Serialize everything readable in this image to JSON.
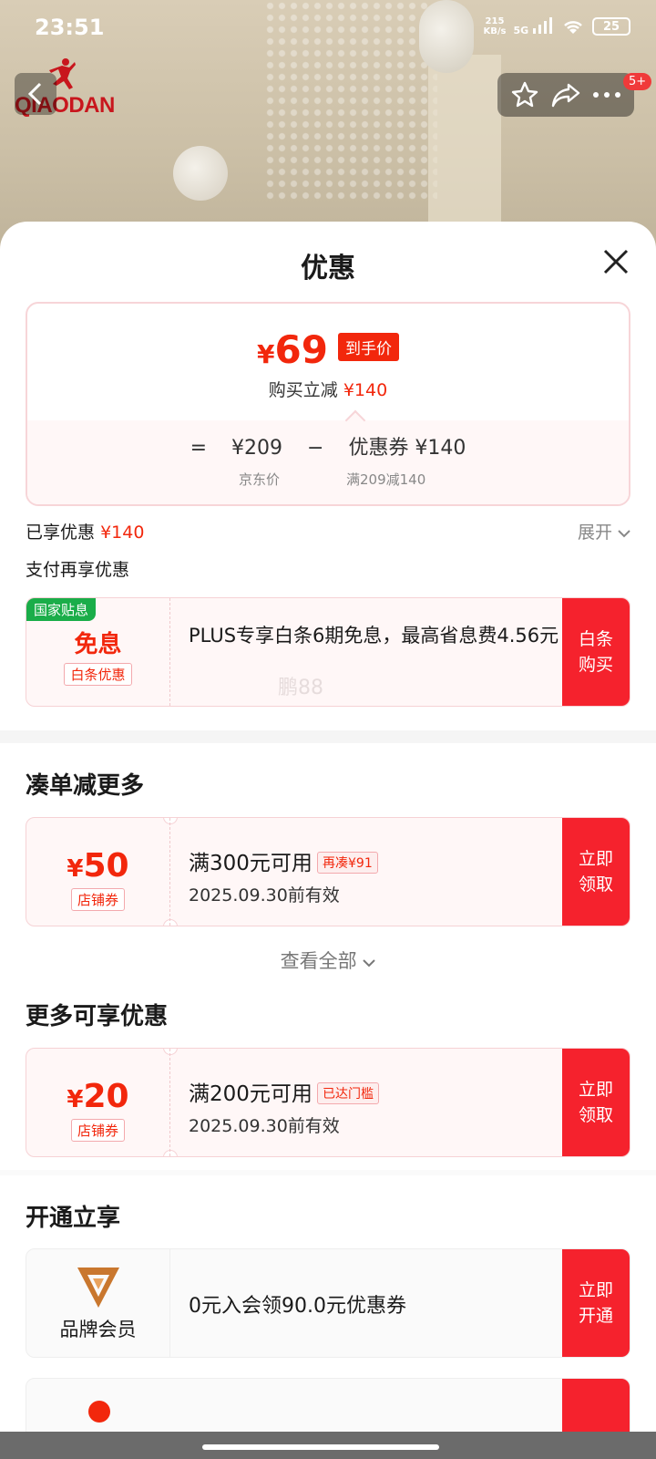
{
  "status": {
    "time": "23:51",
    "netspeed_top": "215",
    "netspeed_unit": "KB/s",
    "signal": "5G",
    "battery": "25"
  },
  "header": {
    "brand": "QIAODAN",
    "badge": "5+"
  },
  "sheet": {
    "title": "优惠"
  },
  "price": {
    "yen": "¥",
    "final": "69",
    "final_tag": "到手价",
    "reduce_label": "购买立减",
    "reduce_value": "¥140",
    "eq": "=",
    "jd_price": "¥209",
    "minus": "−",
    "coupon_label": "优惠券 ¥140",
    "jd_price_label": "京东价",
    "coupon_rule": "满209减140"
  },
  "enjoyed": {
    "label": "已享优惠",
    "value": "¥140",
    "expand": "展开"
  },
  "pay_more": {
    "label": "支付再享优惠"
  },
  "baitiao": {
    "gov_badge": "国家贴息",
    "title": "免息",
    "chip": "白条优惠",
    "desc": "PLUS专享白条6期免息，最高省息费4.56元",
    "watermark": "鹏88",
    "action": "白条购买"
  },
  "section1": {
    "title": "凑单减更多",
    "coupon": {
      "yen": "¥",
      "amount": "50",
      "chip": "店铺券",
      "cond": "满300元可用",
      "tag": "再凑¥91",
      "valid": "2025.09.30前有效",
      "action": "立即领取"
    },
    "see_all": "查看全部"
  },
  "section2": {
    "title": "更多可享优惠",
    "coupon": {
      "yen": "¥",
      "amount": "20",
      "chip": "店铺券",
      "cond": "满200元可用",
      "tag": "已达门槛",
      "valid": "2025.09.30前有效",
      "action": "立即领取"
    }
  },
  "section3": {
    "title": "开通立享",
    "member": {
      "name": "品牌会员",
      "desc": "0元入会领90.0元优惠券",
      "action": "立即开通"
    }
  },
  "colors": {
    "accent": "#f2270c",
    "button": "#f5222d",
    "gov_green": "#1aad49"
  }
}
